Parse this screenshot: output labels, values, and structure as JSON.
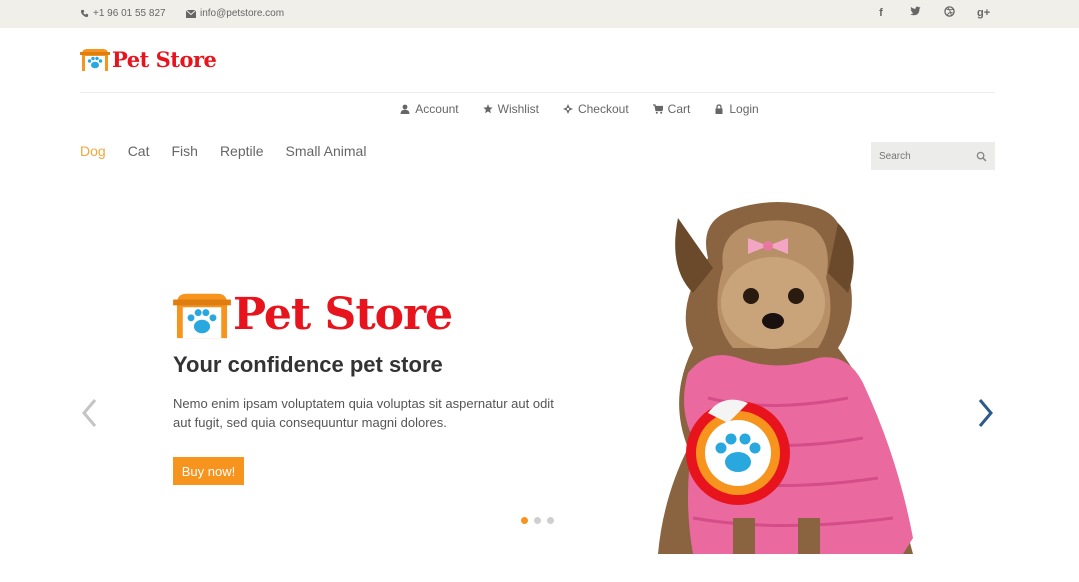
{
  "topbar": {
    "phone": "+1 96 01 55 827",
    "email": "info@petstore.com",
    "social": [
      {
        "name": "facebook-icon",
        "glyph": "f"
      },
      {
        "name": "twitter-icon",
        "glyph": "t"
      },
      {
        "name": "dribbble-icon",
        "glyph": "⊛"
      },
      {
        "name": "google-plus-icon",
        "glyph": "g+"
      }
    ]
  },
  "logo": {
    "text": "Pet Store"
  },
  "usernav": {
    "account": "Account",
    "wishlist": "Wishlist",
    "checkout": "Checkout",
    "cart": "Cart",
    "login": "Login"
  },
  "categories": {
    "dog": "Dog",
    "cat": "Cat",
    "fish": "Fish",
    "reptile": "Reptile",
    "small_animal": "Small Animal"
  },
  "search": {
    "placeholder": "Search"
  },
  "hero": {
    "logo_text": "Pet Store",
    "title": "Your confidence pet store",
    "description": "Nemo enim ipsam voluptatem quia voluptas sit aspernatur aut odit aut fugit, sed quia consequuntur magni dolores.",
    "button": "Buy now!"
  },
  "colors": {
    "accent": "#f6941d",
    "brand_red": "#e8141d",
    "paw_blue": "#29a8e0",
    "topbar_bg": "#f0efea"
  }
}
